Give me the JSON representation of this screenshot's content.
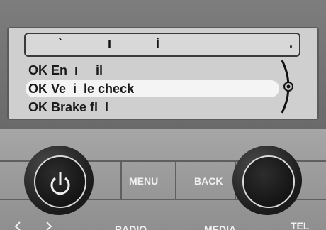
{
  "display": {
    "title_glyphs": [
      "`",
      "ı",
      "i",
      "."
    ],
    "menu_items": [
      {
        "label": "OK En  ı     il",
        "selected": false
      },
      {
        "label": "OK Ve  i  le check",
        "selected": true
      },
      {
        "label": "OK Brake fl  l",
        "selected": false
      }
    ]
  },
  "hardware": {
    "menu_label": "MENU",
    "back_label": "BACK",
    "radio_label": "RADIO",
    "media_label": "MEDIA",
    "tel_label": "TEL"
  },
  "icons": [
    "power-icon",
    "arrow-left-icon",
    "arrow-right-icon",
    "scroll-indicator-icon"
  ]
}
